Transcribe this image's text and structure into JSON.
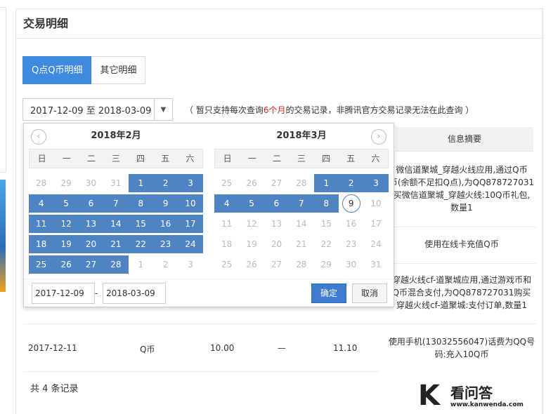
{
  "page_title": "交易明细",
  "tabs": [
    {
      "label": "Q点Q币明细",
      "active": true
    },
    {
      "label": "其它明细",
      "active": false
    }
  ],
  "date_range": {
    "value": "2017-12-09 至 2018-03-09"
  },
  "range_note": {
    "before": "（ 暂只支持每次查询",
    "highlight": "6个月",
    "after": "的交易记录，非腾讯官方交易记录无法在此查询 ）"
  },
  "table": {
    "header": "信息摘要",
    "summaries": [
      "微信道聚城_穿越火线应用,通过Q币",
      "币(余额不足扣Q点),为QQ878727031",
      "买微信道聚城_穿越火线:10Q币礼包,",
      "数量1",
      "使用在线卡充值Q币",
      "穿越火线cf-道聚城应用,通过游戏币和",
      "Q币混合支付,为QQ878727031购买",
      "穿越火线cf-道聚城:支付订单,数量1",
      "使用手机(13032556047)话费为QQ号",
      "码:充入10Q币"
    ],
    "row": {
      "date": "2017-12-11",
      "type": "Q币",
      "amount": "10.00",
      "dash": "—",
      "total": "11.10"
    },
    "total_text": "共 4 条记录"
  },
  "calendar": {
    "prev_icon": "‹",
    "next_icon": "›",
    "months": [
      {
        "title": "2018年2月",
        "weekdays": [
          "日",
          "一",
          "二",
          "三",
          "四",
          "五",
          "六"
        ],
        "days": [
          {
            "d": "28",
            "s": "o"
          },
          {
            "d": "29",
            "s": "o"
          },
          {
            "d": "30",
            "s": "o"
          },
          {
            "d": "31",
            "s": "o"
          },
          {
            "d": "1",
            "s": "sel"
          },
          {
            "d": "2",
            "s": "sel"
          },
          {
            "d": "3",
            "s": "sel"
          },
          {
            "d": "4",
            "s": "sel"
          },
          {
            "d": "5",
            "s": "sel"
          },
          {
            "d": "6",
            "s": "sel"
          },
          {
            "d": "7",
            "s": "sel"
          },
          {
            "d": "8",
            "s": "sel"
          },
          {
            "d": "9",
            "s": "sel"
          },
          {
            "d": "10",
            "s": "sel"
          },
          {
            "d": "11",
            "s": "sel"
          },
          {
            "d": "12",
            "s": "sel"
          },
          {
            "d": "13",
            "s": "sel"
          },
          {
            "d": "14",
            "s": "sel"
          },
          {
            "d": "15",
            "s": "sel"
          },
          {
            "d": "16",
            "s": "sel"
          },
          {
            "d": "17",
            "s": "sel"
          },
          {
            "d": "18",
            "s": "sel"
          },
          {
            "d": "19",
            "s": "sel"
          },
          {
            "d": "20",
            "s": "sel"
          },
          {
            "d": "21",
            "s": "sel"
          },
          {
            "d": "22",
            "s": "sel"
          },
          {
            "d": "23",
            "s": "sel"
          },
          {
            "d": "24",
            "s": "sel"
          },
          {
            "d": "25",
            "s": "sel"
          },
          {
            "d": "26",
            "s": "sel"
          },
          {
            "d": "27",
            "s": "sel"
          },
          {
            "d": "28",
            "s": "sel"
          },
          {
            "d": "1",
            "s": "o"
          },
          {
            "d": "2",
            "s": "o"
          },
          {
            "d": "3",
            "s": "o"
          }
        ]
      },
      {
        "title": "2018年3月",
        "weekdays": [
          "日",
          "一",
          "二",
          "三",
          "四",
          "五",
          "六"
        ],
        "days": [
          {
            "d": "25",
            "s": "o"
          },
          {
            "d": "26",
            "s": "o"
          },
          {
            "d": "27",
            "s": "o"
          },
          {
            "d": "28",
            "s": "o"
          },
          {
            "d": "1",
            "s": "sel"
          },
          {
            "d": "2",
            "s": "sel"
          },
          {
            "d": "3",
            "s": "sel"
          },
          {
            "d": "4",
            "s": "sel"
          },
          {
            "d": "5",
            "s": "sel"
          },
          {
            "d": "6",
            "s": "sel"
          },
          {
            "d": "7",
            "s": "sel"
          },
          {
            "d": "8",
            "s": "sel"
          },
          {
            "d": "9",
            "s": "cur"
          },
          {
            "d": "10",
            "s": "o"
          },
          {
            "d": "11",
            "s": "o"
          },
          {
            "d": "12",
            "s": "o"
          },
          {
            "d": "13",
            "s": "o"
          },
          {
            "d": "14",
            "s": "o"
          },
          {
            "d": "15",
            "s": "o"
          },
          {
            "d": "16",
            "s": "o"
          },
          {
            "d": "17",
            "s": "o"
          },
          {
            "d": "18",
            "s": "o"
          },
          {
            "d": "19",
            "s": "o"
          },
          {
            "d": "20",
            "s": "o"
          },
          {
            "d": "21",
            "s": "o"
          },
          {
            "d": "22",
            "s": "o"
          },
          {
            "d": "23",
            "s": "o"
          },
          {
            "d": "24",
            "s": "o"
          },
          {
            "d": "25",
            "s": "o"
          },
          {
            "d": "26",
            "s": "o"
          },
          {
            "d": "27",
            "s": "o"
          },
          {
            "d": "28",
            "s": "o"
          },
          {
            "d": "29",
            "s": "o"
          },
          {
            "d": "30",
            "s": "o"
          },
          {
            "d": "31",
            "s": "o"
          }
        ]
      }
    ],
    "start_value": "2017-12-09",
    "end_value": "2018-03-09",
    "dash": "-",
    "ok_label": "确定",
    "cancel_label": "取消"
  },
  "watermark": {
    "k": "K",
    "cn": "看问答",
    "url": "www.kanwenda.com"
  },
  "colors": {
    "accent": "#3d8ae0",
    "selected_day": "#4f84c4",
    "highlight_text": "#d2281f"
  }
}
